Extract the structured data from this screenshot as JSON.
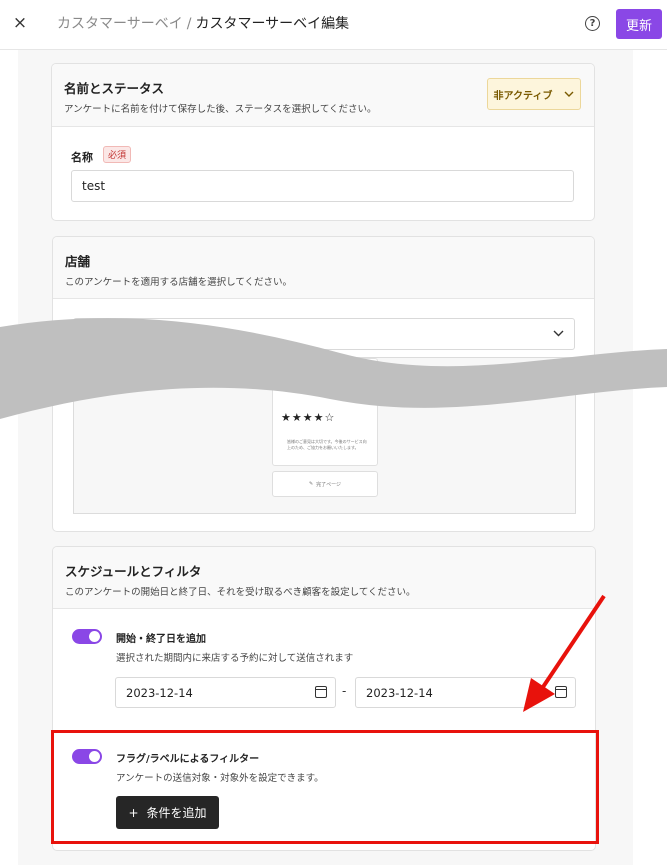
{
  "header": {
    "close_icon": "×",
    "breadcrumb_parent": "カスタマーサーベイ",
    "breadcrumb_sep": "/",
    "breadcrumb_current": "カスタマーサーベイ編集",
    "help_icon": "?",
    "update_label": "更新"
  },
  "name_section": {
    "title": "名前とステータス",
    "desc": "アンケートに名前を付けて保存した後、ステータスを選択してください。",
    "status_value": "非アクティブ",
    "name_label": "名称",
    "required_badge": "必須",
    "name_value": "test"
  },
  "store_section": {
    "title": "店舗",
    "desc": "このアンケートを適用する店舗を選択してください。",
    "stars": "★★★★☆",
    "preview_text": "皆様のご意見は大切です。今後のサービス向上のため、ご協力をお願いいたします。",
    "preview_button": "完了ページ"
  },
  "schedule_section": {
    "title": "スケジュールとフィルタ",
    "desc": "このアンケートの開始日と終了日、それを受け取るべき顧客を設定してください。",
    "date_toggle_title": "開始・終了日を追加",
    "date_toggle_desc": "選択された期間内に来店する予約に対して送信されます",
    "start_date": "2023-12-14",
    "end_date": "2023-12-14",
    "date_sep": "-",
    "filter_toggle_title": "フラグ/ラベルによるフィルター",
    "filter_toggle_desc": "アンケートの送信対象・対象外を設定できます。",
    "add_condition_label": "条件を追加",
    "add_condition_plus": "+"
  },
  "colors": {
    "accent": "#8a47e6",
    "highlight": "#e8120c",
    "status_bg": "#fdf5dc"
  }
}
